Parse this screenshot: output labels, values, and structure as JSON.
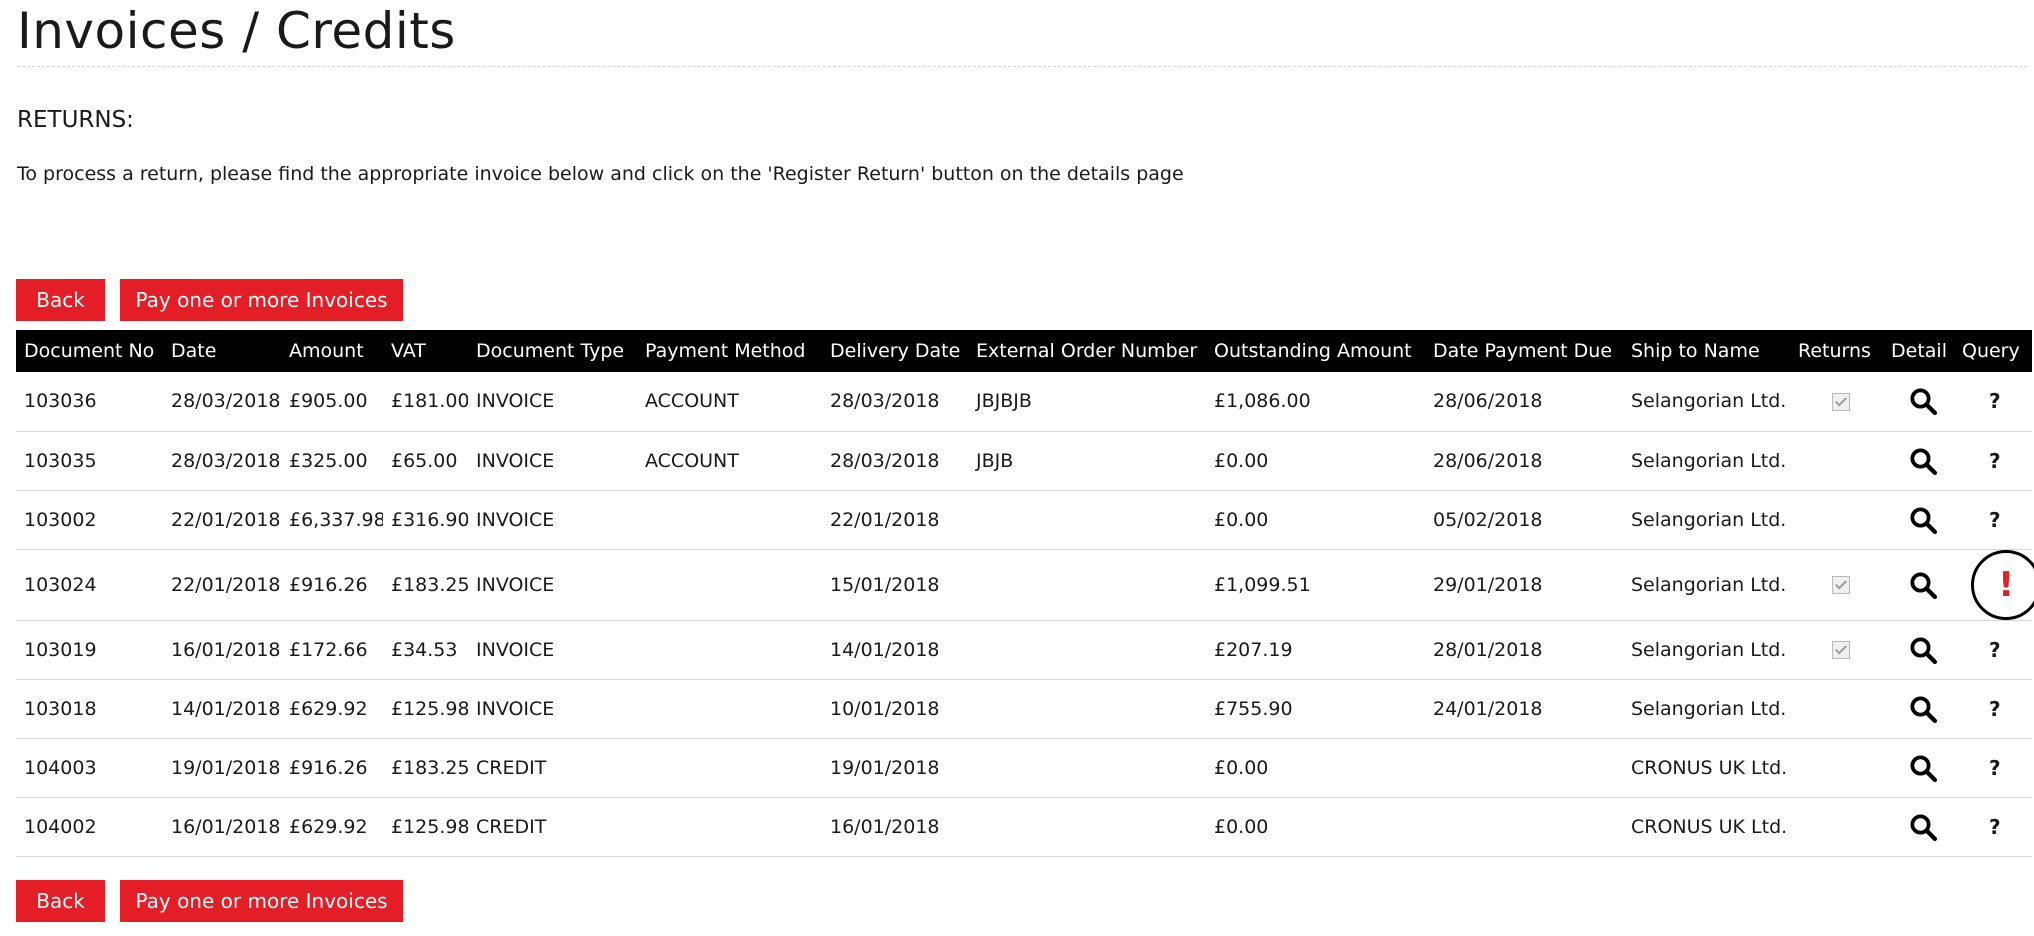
{
  "page": {
    "title": "Invoices / Credits",
    "returns_heading": "RETURNS:",
    "instructions": "To process a return, please find the appropriate invoice below and click on the 'Register Return' button on the details page"
  },
  "buttons": {
    "back": "Back",
    "pay": "Pay one or more Invoices"
  },
  "colors": {
    "accent": "#e41e26",
    "header_bg": "#000000"
  },
  "table": {
    "headers": [
      "Document No",
      "Date",
      "Amount",
      "VAT",
      "Document Type",
      "Payment Method",
      "Delivery Date",
      "External Order Number",
      "Outstanding Amount",
      "Date Payment Due",
      "Ship to Name",
      "Returns",
      "Detail",
      "Query"
    ],
    "rows": [
      {
        "doc_no": "103036",
        "date": "28/03/2018",
        "amount": "£905.00",
        "vat": "£181.00",
        "doc_type": "INVOICE",
        "payment_method": "ACCOUNT",
        "delivery_date": "28/03/2018",
        "external_order": "JBJBJB",
        "outstanding": "£1,086.00",
        "due_date": "28/06/2018",
        "ship_to": "Selangorian Ltd.",
        "returns": true,
        "detail_icon": "search-icon",
        "query": "?"
      },
      {
        "doc_no": "103035",
        "date": "28/03/2018",
        "amount": "£325.00",
        "vat": "£65.00",
        "doc_type": "INVOICE",
        "payment_method": "ACCOUNT",
        "delivery_date": "28/03/2018",
        "external_order": "JBJB",
        "outstanding": "£0.00",
        "due_date": "28/06/2018",
        "ship_to": "Selangorian Ltd.",
        "returns": false,
        "detail_icon": "search-icon",
        "query": "?"
      },
      {
        "doc_no": "103002",
        "date": "22/01/2018",
        "amount": "£6,337.98",
        "vat": "£316.90",
        "doc_type": "INVOICE",
        "payment_method": "",
        "delivery_date": "22/01/2018",
        "external_order": "",
        "outstanding": "£0.00",
        "due_date": "05/02/2018",
        "ship_to": "Selangorian Ltd.",
        "returns": false,
        "detail_icon": "search-icon",
        "query": "?"
      },
      {
        "doc_no": "103024",
        "date": "22/01/2018",
        "amount": "£916.26",
        "vat": "£183.25",
        "doc_type": "INVOICE",
        "payment_method": "",
        "delivery_date": "15/01/2018",
        "external_order": "",
        "outstanding": "£1,099.51",
        "due_date": "29/01/2018",
        "ship_to": "Selangorian Ltd.",
        "returns": true,
        "detail_icon": "search-icon",
        "query": "!"
      },
      {
        "doc_no": "103019",
        "date": "16/01/2018",
        "amount": "£172.66",
        "vat": "£34.53",
        "doc_type": "INVOICE",
        "payment_method": "",
        "delivery_date": "14/01/2018",
        "external_order": "",
        "outstanding": "£207.19",
        "due_date": "28/01/2018",
        "ship_to": "Selangorian Ltd.",
        "returns": true,
        "detail_icon": "search-icon",
        "query": "?"
      },
      {
        "doc_no": "103018",
        "date": "14/01/2018",
        "amount": "£629.92",
        "vat": "£125.98",
        "doc_type": "INVOICE",
        "payment_method": "",
        "delivery_date": "10/01/2018",
        "external_order": "",
        "outstanding": "£755.90",
        "due_date": "24/01/2018",
        "ship_to": "Selangorian Ltd.",
        "returns": false,
        "detail_icon": "search-icon",
        "query": "?"
      },
      {
        "doc_no": "104003",
        "date": "19/01/2018",
        "amount": "£916.26",
        "vat": "£183.25",
        "doc_type": "CREDIT",
        "payment_method": "",
        "delivery_date": "19/01/2018",
        "external_order": "",
        "outstanding": "£0.00",
        "due_date": "",
        "ship_to": "CRONUS UK Ltd.",
        "returns": false,
        "detail_icon": "search-icon",
        "query": "?"
      },
      {
        "doc_no": "104002",
        "date": "16/01/2018",
        "amount": "£629.92",
        "vat": "£125.98",
        "doc_type": "CREDIT",
        "payment_method": "",
        "delivery_date": "16/01/2018",
        "external_order": "",
        "outstanding": "£0.00",
        "due_date": "",
        "ship_to": "CRONUS UK Ltd.",
        "returns": false,
        "detail_icon": "search-icon",
        "query": "?"
      }
    ]
  }
}
